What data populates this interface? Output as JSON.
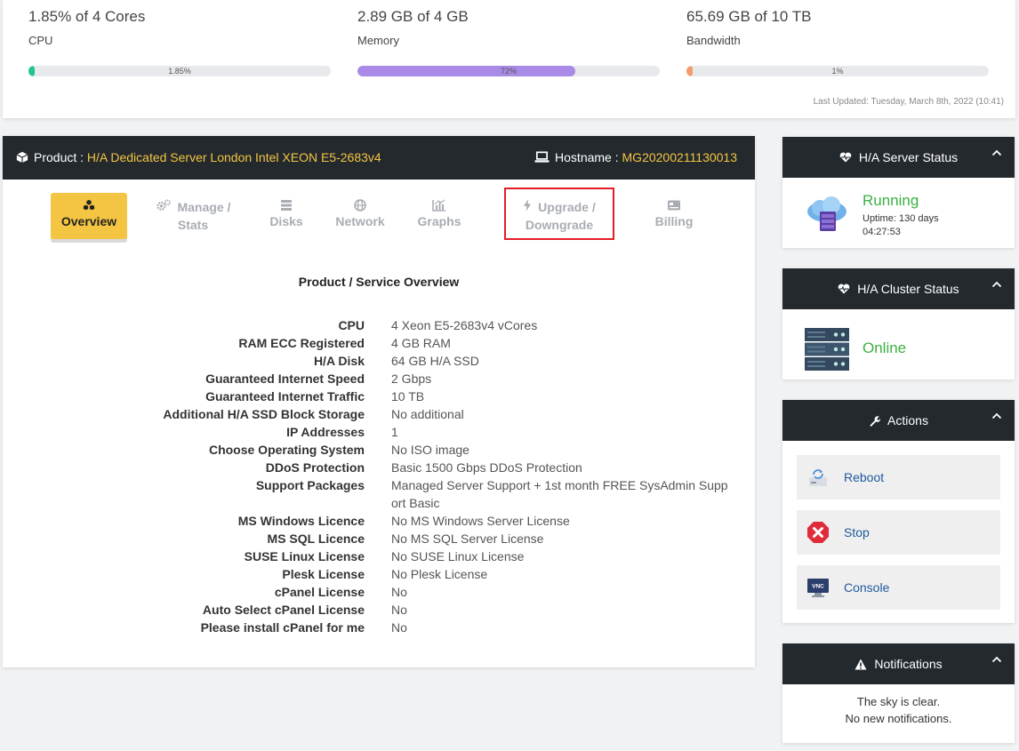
{
  "usage": {
    "cpu": {
      "value": "1.85% of 4 Cores",
      "label": "CPU",
      "percent_text": "1.85%",
      "percent": 1.85,
      "color": "#1fc48e"
    },
    "memory": {
      "value": "2.89 GB of 4 GB",
      "label": "Memory",
      "percent_text": "72%",
      "percent": 72,
      "color": "#a98ae6"
    },
    "bandwidth": {
      "value": "65.69 GB of 10 TB",
      "label": "Bandwidth",
      "percent_text": "1%",
      "percent": 1,
      "color": "#f49b6c"
    },
    "last_updated": "Last Updated: Tuesday, March 8th, 2022 (10:41)"
  },
  "product": {
    "product_label": "Product : ",
    "product_name": "H/A Dedicated Server London Intel XEON E5-2683v4",
    "hostname_label": "Hostname : ",
    "hostname": "MG20200211130013",
    "tabs": [
      {
        "label": "Overview",
        "icon": "cubes-icon"
      },
      {
        "label": "Manage / Stats",
        "icon": "gears-icon"
      },
      {
        "label": "Disks",
        "icon": "database-icon"
      },
      {
        "label": "Network",
        "icon": "globe-icon"
      },
      {
        "label": "Graphs",
        "icon": "chart-icon"
      },
      {
        "label": "Upgrade / Downgrade",
        "icon": "bolt-icon"
      },
      {
        "label": "Billing",
        "icon": "card-icon"
      }
    ],
    "section_title": "Product / Service Overview",
    "details": [
      {
        "label": "CPU",
        "value": "4 Xeon E5-2683v4 vCores"
      },
      {
        "label": "RAM ECC Registered",
        "value": "4 GB RAM"
      },
      {
        "label": "H/A Disk",
        "value": "64 GB H/A SSD"
      },
      {
        "label": "Guaranteed Internet Speed",
        "value": "2 Gbps"
      },
      {
        "label": "Guaranteed Internet Traffic",
        "value": "10 TB"
      },
      {
        "label": "Additional H/A SSD Block Storage",
        "value": "No additional"
      },
      {
        "label": "IP Addresses",
        "value": "1"
      },
      {
        "label": "Choose Operating System",
        "value": "No ISO image"
      },
      {
        "label": "DDoS Protection",
        "value": "Basic 1500 Gbps DDoS Protection"
      },
      {
        "label": "Support Packages",
        "value": "Managed Server Support + 1st month FREE SysAdmin Support Basic"
      },
      {
        "label": "MS Windows Licence",
        "value": "No MS Windows Server License"
      },
      {
        "label": "MS SQL Licence",
        "value": "No MS SQL Server License"
      },
      {
        "label": "SUSE Linux License",
        "value": "No SUSE Linux License"
      },
      {
        "label": "Plesk License",
        "value": "No Plesk License"
      },
      {
        "label": "cPanel License",
        "value": "No"
      },
      {
        "label": "Auto Select cPanel License",
        "value": "No"
      },
      {
        "label": "Please install cPanel for me",
        "value": "No"
      }
    ]
  },
  "server_status": {
    "title": "H/A Server Status",
    "status": "Running",
    "uptime": "Uptime: 130 days 04:27:53",
    "status_color": "#3cb043"
  },
  "cluster_status": {
    "title": "H/A Cluster Status",
    "status": "Online"
  },
  "actions": {
    "title": "Actions",
    "items": [
      {
        "label": "Reboot",
        "icon": "reboot-icon"
      },
      {
        "label": "Stop",
        "icon": "stop-icon"
      },
      {
        "label": "Console",
        "icon": "vnc-console-icon",
        "icon_text": "VNC"
      }
    ]
  },
  "notifications": {
    "title": "Notifications",
    "line1": "The sky is clear.",
    "line2": "No new notifications."
  }
}
